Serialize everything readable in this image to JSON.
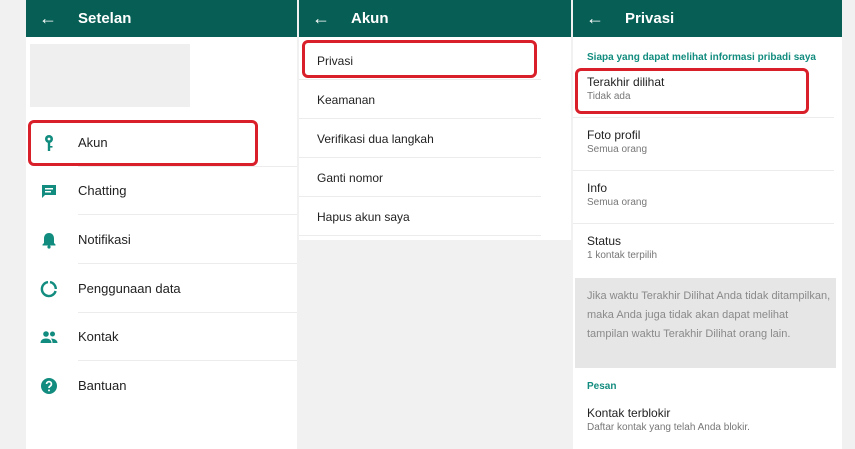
{
  "colors": {
    "appbar": "#075e54",
    "accent": "#128c7e",
    "highlight": "#d9202a"
  },
  "settings": {
    "title": "Setelan",
    "back_icon": "arrow-left-icon",
    "items": [
      {
        "label": "Akun",
        "icon": "key-icon"
      },
      {
        "label": "Chatting",
        "icon": "chat-icon"
      },
      {
        "label": "Notifikasi",
        "icon": "bell-icon"
      },
      {
        "label": "Penggunaan data",
        "icon": "data-usage-icon"
      },
      {
        "label": "Kontak",
        "icon": "contacts-icon"
      },
      {
        "label": "Bantuan",
        "icon": "help-icon"
      }
    ]
  },
  "account": {
    "title": "Akun",
    "back_icon": "arrow-left-icon",
    "items": [
      {
        "label": "Privasi"
      },
      {
        "label": "Keamanan"
      },
      {
        "label": "Verifikasi dua langkah"
      },
      {
        "label": "Ganti nomor"
      },
      {
        "label": "Hapus akun saya"
      }
    ]
  },
  "privacy": {
    "title": "Privasi",
    "back_icon": "arrow-left-icon",
    "section_personal": "Siapa yang dapat melihat informasi pribadi saya",
    "items": [
      {
        "title": "Terakhir dilihat",
        "value": "Tidak ada"
      },
      {
        "title": "Foto profil",
        "value": "Semua orang"
      },
      {
        "title": "Info",
        "value": "Semua orang"
      },
      {
        "title": "Status",
        "value": "1 kontak terpilih"
      }
    ],
    "note": "Jika waktu Terakhir Dilihat Anda tidak ditampilkan, maka Anda juga tidak akan dapat melihat tampilan waktu Terakhir Dilihat orang lain.",
    "section_messages": "Pesan",
    "blocked": {
      "title": "Kontak terblokir",
      "value": "Daftar kontak yang telah Anda blokir."
    }
  }
}
